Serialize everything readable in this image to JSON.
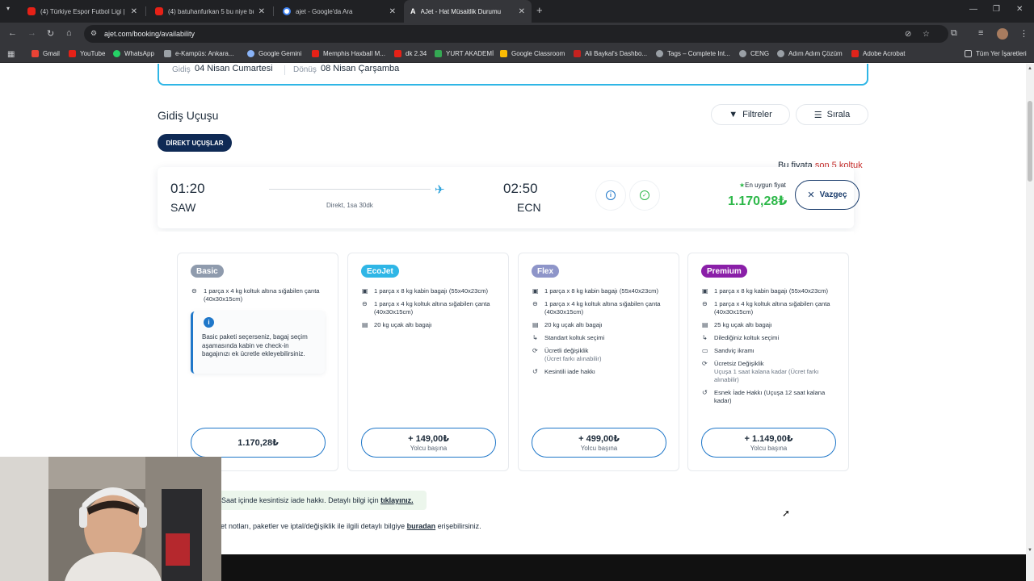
{
  "browser": {
    "tabs": [
      {
        "title": "(4) Türkiye Espor Futbol Ligi | 1:"
      },
      {
        "title": "(4) batuhanfurkan 5 bu niye bu"
      },
      {
        "title": "ajet - Google'da Ara"
      },
      {
        "title": "AJet - Hat Müsaitlik Durumu"
      }
    ],
    "url": "ajet.com/booking/availability",
    "bookmarks": [
      {
        "label": "Gmail",
        "color": "#ea4335"
      },
      {
        "label": "YouTube",
        "color": "#e62117"
      },
      {
        "label": "WhatsApp",
        "color": "#25d366"
      },
      {
        "label": "e-Kampüs: Ankara...",
        "color": "#9aa0a6"
      },
      {
        "label": "Google Gemini",
        "color": "#8ab4f8"
      },
      {
        "label": "Memphis Haxball M...",
        "color": "#e62117"
      },
      {
        "label": "dk 2.34",
        "color": "#e62117"
      },
      {
        "label": "YURT AKADEMİ",
        "color": "#34a853"
      },
      {
        "label": "Google Classroom",
        "color": "#fbbc04"
      },
      {
        "label": "Ali Baykal's Dashbo...",
        "color": "#c5221f"
      },
      {
        "label": "Tags – Complete Int...",
        "color": "#9aa0a6"
      },
      {
        "label": "CENG",
        "color": "#9aa0a6"
      },
      {
        "label": "Adım Adım Çözüm",
        "color": "#9aa0a6"
      },
      {
        "label": "Adobe Acrobat",
        "color": "#e0241b"
      }
    ],
    "all_bookmarks": "Tüm Yer İşaretleri"
  },
  "search_summary": {
    "departure_label": "Gidiş",
    "departure_date": "04 Nisan Cumartesi",
    "return_label": "Dönüş",
    "return_date": "08 Nisan Çarşamba"
  },
  "section": {
    "title": "Gidiş Uçuşu",
    "filter_label": "Filtreler",
    "sort_label": "Sırala",
    "direct_label": "DİREKT UÇUŞLAR",
    "seat_note_prefix": "Bu fiyata",
    "seat_note_highlight": "son 5 koltuk"
  },
  "flight": {
    "dep_time": "01:20",
    "dep_code": "SAW",
    "arr_time": "02:50",
    "arr_code": "ECN",
    "duration": "Direkt, 1sa 30dk",
    "best_label": "En uygun fiyat",
    "best_price": "1.170,28₺",
    "cancel_label": "Vazgeç"
  },
  "packages": [
    {
      "name": "Basic",
      "color": "#8f9bad",
      "features": [
        {
          "icon": "seat-bag-icon",
          "text": "1 parça x 4 kg koltuk altına sığabilen çanta (40x30x15cm)"
        }
      ],
      "info": "Basic paketi seçerseniz, bagaj seçim aşamasında kabin ve check-in bagajınızı ek ücretle ekleyebilirsiniz.",
      "price": "1.170,28₺",
      "per_person": ""
    },
    {
      "name": "EcoJet",
      "color": "#2fb6e6",
      "features": [
        {
          "icon": "cabin-bag-icon",
          "text": "1 parça x 8 kg kabin bagajı (55x40x23cm)"
        },
        {
          "icon": "seat-bag-icon",
          "text": "1 parça x 4 kg koltuk altına sığabilen çanta (40x30x15cm)"
        },
        {
          "icon": "luggage-icon",
          "text": "20 kg uçak altı bagajı"
        }
      ],
      "price": "+ 149,00₺",
      "per_person": "Yolcu başına"
    },
    {
      "name": "Flex",
      "color": "#8e95c9",
      "features": [
        {
          "icon": "cabin-bag-icon",
          "text": "1 parça x 8 kg kabin bagajı (55x40x23cm)"
        },
        {
          "icon": "seat-bag-icon",
          "text": "1 parça x 4 kg koltuk altına sığabilen çanta (40x30x15cm)"
        },
        {
          "icon": "luggage-icon",
          "text": "20 kg uçak altı bagajı"
        },
        {
          "icon": "seat-icon",
          "text": "Standart koltuk seçimi"
        },
        {
          "icon": "change-icon",
          "text": "Ücretli değişiklik",
          "sub": "(Ücret farkı alınabilir)"
        },
        {
          "icon": "refund-icon",
          "text": "Kesintili iade hakkı"
        }
      ],
      "price": "+ 499,00₺",
      "per_person": "Yolcu başına"
    },
    {
      "name": "Premium",
      "color": "#8a1fa8",
      "features": [
        {
          "icon": "cabin-bag-icon",
          "text": "1 parça x 8 kg kabin bagajı (55x40x23cm)"
        },
        {
          "icon": "seat-bag-icon",
          "text": "1 parça x 4 kg koltuk altına sığabilen çanta (40x30x15cm)"
        },
        {
          "icon": "luggage-icon",
          "text": "25 kg uçak altı bagajı"
        },
        {
          "icon": "seat-icon",
          "text": "Dilediğiniz koltuk seçimi"
        },
        {
          "icon": "sandwich-icon",
          "text": "Sandviç ikramı"
        },
        {
          "icon": "change-icon",
          "text": "Ücretsiz Değişiklik",
          "sub": "Uçuşa 1 saat kalana kadar (Ücret farkı alınabilir)"
        },
        {
          "icon": "refund-icon",
          "text": "Esnek İade Hakkı (Uçuşa 12 saat kalana kadar)"
        }
      ],
      "price": "+ 1.149,00₺",
      "per_person": "Yolcu başına"
    }
  ],
  "notices": {
    "refund_text": "Saat içinde kesintisiz iade hakkı. Detaylı bilgi için",
    "refund_link": "tıklayınız.",
    "fare_text_pre": "ret notları, paketler ve iptal/değişiklik ile ilgili detaylı bilgiye",
    "fare_link": "buradan",
    "fare_text_post": "erişebilirsiniz."
  }
}
